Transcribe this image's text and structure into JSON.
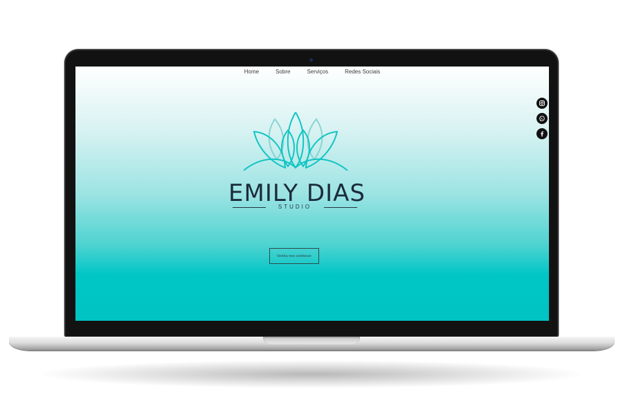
{
  "nav": {
    "items": [
      {
        "label": "Home"
      },
      {
        "label": "Sobre"
      },
      {
        "label": "Serviços"
      },
      {
        "label": "Redes Sociais"
      }
    ]
  },
  "brand": {
    "name": "EMILY DIAS",
    "subtitle": "STUDIO"
  },
  "hero": {
    "cta_label": "Venha nos conhecer"
  },
  "social": [
    {
      "icon": "instagram-icon"
    },
    {
      "icon": "whatsapp-icon"
    },
    {
      "icon": "facebook-icon"
    }
  ],
  "colors": {
    "accent": "#00c6c6",
    "logo": "#12c4c4",
    "text_dark": "#1b2b3b"
  }
}
